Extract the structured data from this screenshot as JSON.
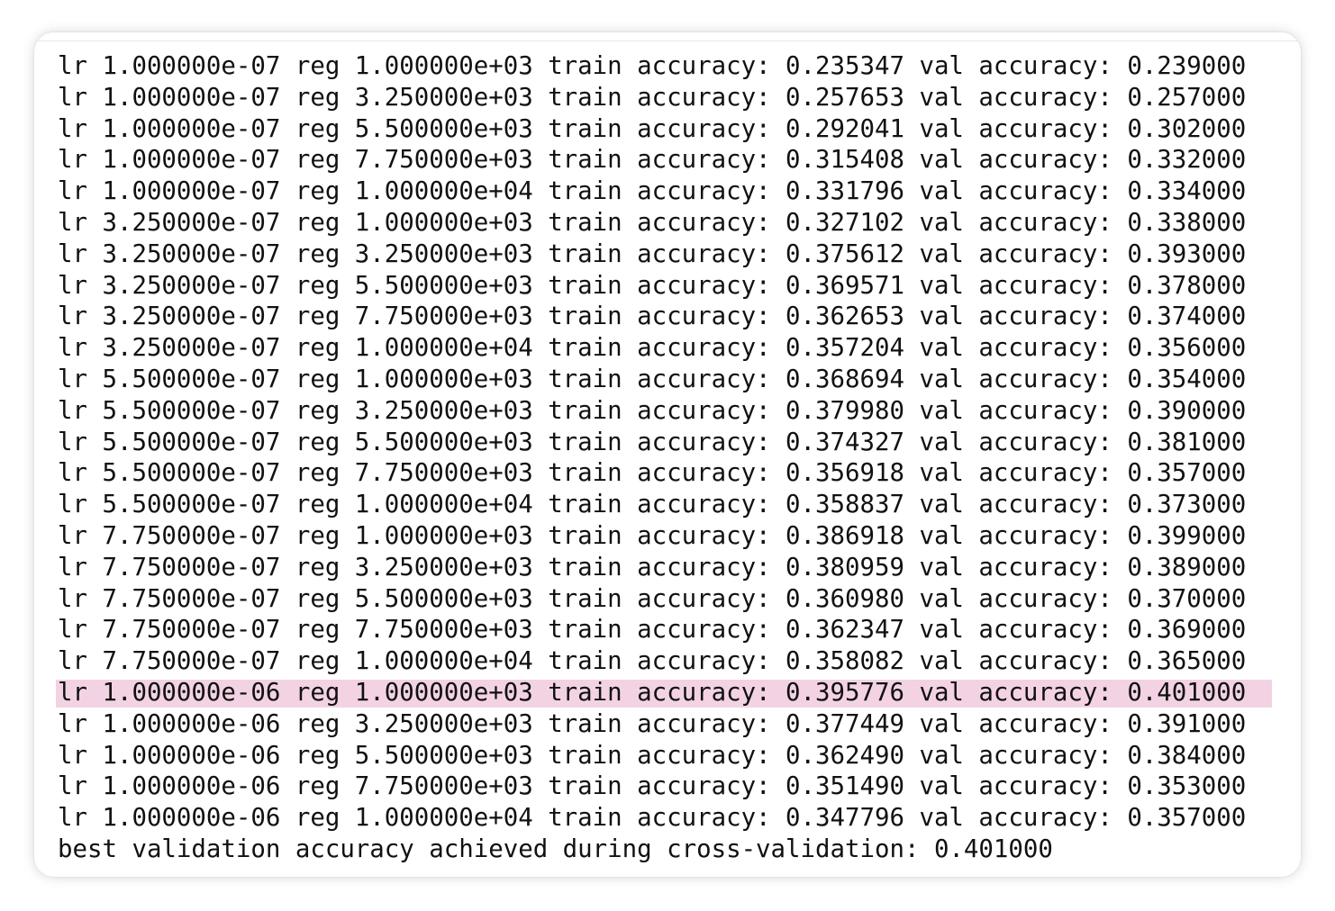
{
  "highlight_color": "#f3d3e3",
  "log_lines": [
    "lr 1.000000e-07 reg 1.000000e+03 train accuracy: 0.235347 val accuracy: 0.239000",
    "lr 1.000000e-07 reg 3.250000e+03 train accuracy: 0.257653 val accuracy: 0.257000",
    "lr 1.000000e-07 reg 5.500000e+03 train accuracy: 0.292041 val accuracy: 0.302000",
    "lr 1.000000e-07 reg 7.750000e+03 train accuracy: 0.315408 val accuracy: 0.332000",
    "lr 1.000000e-07 reg 1.000000e+04 train accuracy: 0.331796 val accuracy: 0.334000",
    "lr 3.250000e-07 reg 1.000000e+03 train accuracy: 0.327102 val accuracy: 0.338000",
    "lr 3.250000e-07 reg 3.250000e+03 train accuracy: 0.375612 val accuracy: 0.393000",
    "lr 3.250000e-07 reg 5.500000e+03 train accuracy: 0.369571 val accuracy: 0.378000",
    "lr 3.250000e-07 reg 7.750000e+03 train accuracy: 0.362653 val accuracy: 0.374000",
    "lr 3.250000e-07 reg 1.000000e+04 train accuracy: 0.357204 val accuracy: 0.356000",
    "lr 5.500000e-07 reg 1.000000e+03 train accuracy: 0.368694 val accuracy: 0.354000",
    "lr 5.500000e-07 reg 3.250000e+03 train accuracy: 0.379980 val accuracy: 0.390000",
    "lr 5.500000e-07 reg 5.500000e+03 train accuracy: 0.374327 val accuracy: 0.381000",
    "lr 5.500000e-07 reg 7.750000e+03 train accuracy: 0.356918 val accuracy: 0.357000",
    "lr 5.500000e-07 reg 1.000000e+04 train accuracy: 0.358837 val accuracy: 0.373000",
    "lr 7.750000e-07 reg 1.000000e+03 train accuracy: 0.386918 val accuracy: 0.399000",
    "lr 7.750000e-07 reg 3.250000e+03 train accuracy: 0.380959 val accuracy: 0.389000",
    "lr 7.750000e-07 reg 5.500000e+03 train accuracy: 0.360980 val accuracy: 0.370000",
    "lr 7.750000e-07 reg 7.750000e+03 train accuracy: 0.362347 val accuracy: 0.369000",
    "lr 7.750000e-07 reg 1.000000e+04 train accuracy: 0.358082 val accuracy: 0.365000",
    "lr 1.000000e-06 reg 1.000000e+03 train accuracy: 0.395776 val accuracy: 0.401000",
    "lr 1.000000e-06 reg 3.250000e+03 train accuracy: 0.377449 val accuracy: 0.391000",
    "lr 1.000000e-06 reg 5.500000e+03 train accuracy: 0.362490 val accuracy: 0.384000",
    "lr 1.000000e-06 reg 7.750000e+03 train accuracy: 0.351490 val accuracy: 0.353000",
    "lr 1.000000e-06 reg 1.000000e+04 train accuracy: 0.347796 val accuracy: 0.357000"
  ],
  "highlighted_line": 21,
  "summary_line": "best validation accuracy achieved during cross-validation: 0.401000"
}
